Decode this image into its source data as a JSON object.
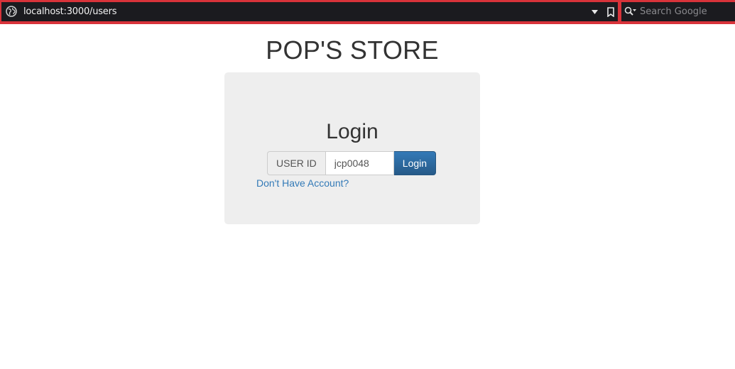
{
  "browser": {
    "url": "localhost:3000/users",
    "search_placeholder": "Search Google"
  },
  "page": {
    "title": "POP'S STORE"
  },
  "login": {
    "heading": "Login",
    "userid_label": "USER ID",
    "userid_value": "jcp0048",
    "button_label": "Login",
    "signup_link": "Don't Have Account?"
  },
  "colors": {
    "toolbar_border": "#d8333a",
    "toolbar_bg": "#1b1b1f",
    "panel_bg": "#eeeeee",
    "primary": "#337ab7",
    "link": "#337ab7"
  },
  "icons": [
    "globe-icon",
    "chevron-down-icon",
    "bookmark-icon",
    "search-icon"
  ]
}
